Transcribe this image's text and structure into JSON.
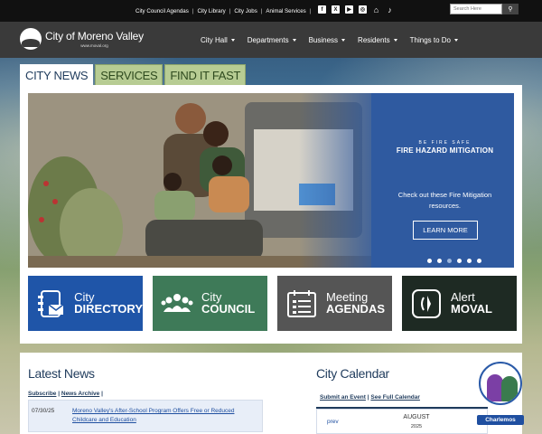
{
  "utility": {
    "links": [
      "City Council Agendas",
      "City Library",
      "City Jobs",
      "Animal Services"
    ],
    "icons": [
      "facebook-icon",
      "x-icon",
      "youtube-icon",
      "instagram-icon",
      "home-icon",
      "tiktok-icon"
    ],
    "search_placeholder": "Search Here"
  },
  "header": {
    "logo_name": "City of Moreno Valley",
    "logo_url": "www.moval.org",
    "menu": [
      "City Hall",
      "Departments",
      "Business",
      "Residents",
      "Things to Do"
    ]
  },
  "tabs": [
    "CITY NEWS",
    "SERVICES",
    "FIND IT FAST"
  ],
  "hero": {
    "kicker": "BE FIRE SAFE",
    "title": "FIRE HAZARD MITIGATION",
    "description": "Check out these Fire Mitigation resources.",
    "button": "LEARN MORE",
    "slide_count": 6,
    "active_slide": 2
  },
  "tiles": [
    {
      "line1": "City",
      "line2": "DIRECTORY",
      "color": "#1f55a8",
      "icon": "directory-icon"
    },
    {
      "line1": "City",
      "line2": "COUNCIL",
      "color": "#3e7a58",
      "icon": "council-icon"
    },
    {
      "line1": "Meeting",
      "line2": "AGENDAS",
      "color": "#555555",
      "icon": "agendas-icon"
    },
    {
      "line1": "Alert",
      "line2": "MOVAL",
      "color": "#1e2a23",
      "icon": "alert-icon"
    }
  ],
  "news": {
    "heading": "Latest News",
    "subscribe": "Subscribe",
    "archive": "News Archive",
    "items": [
      {
        "date": "07/30/25",
        "title": "Moreno Valley's After-School Program Offers Free or Reduced Childcare and Education"
      }
    ]
  },
  "calendar": {
    "heading": "City Calendar",
    "submit": "Submit an Event",
    "full": "See Full Calendar",
    "prev": "prev",
    "month": "AUGUST",
    "year": "2025"
  },
  "chat": {
    "label": "Charlemos"
  }
}
